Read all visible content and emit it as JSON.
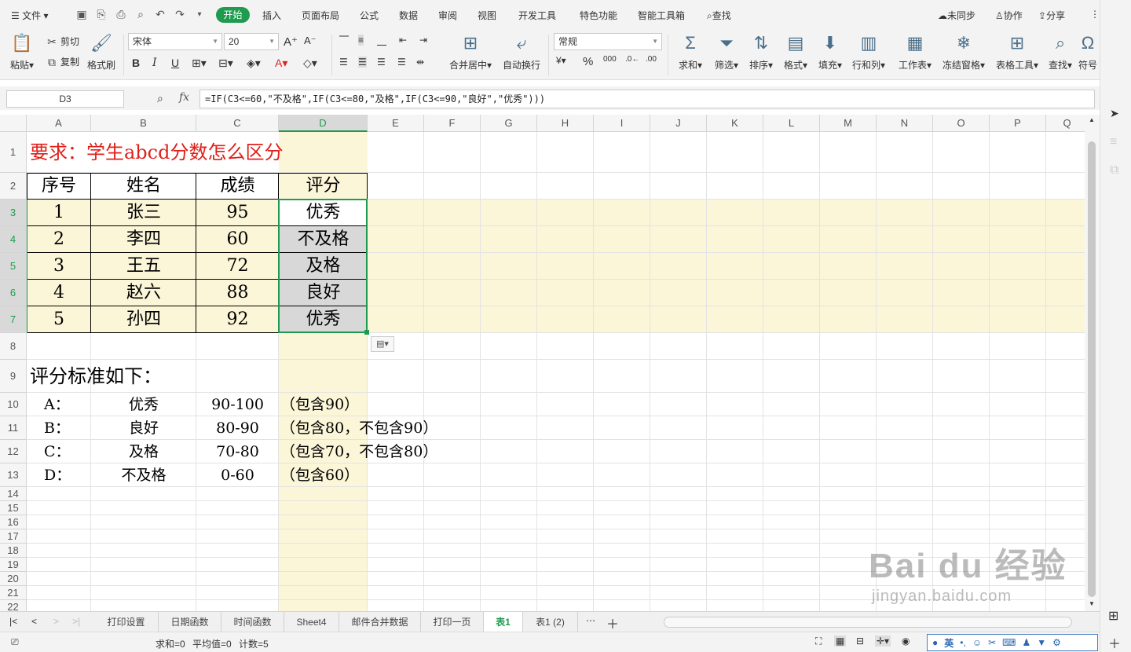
{
  "menubar": {
    "file": "文件",
    "tabs": [
      "开始",
      "插入",
      "页面布局",
      "公式",
      "数据",
      "审阅",
      "视图",
      "开发工具",
      "特色功能",
      "智能工具箱"
    ],
    "active_tab": "开始",
    "search": "查找",
    "sync": "未同步",
    "collab": "协作",
    "share": "分享"
  },
  "ribbon": {
    "paste": "粘贴",
    "cut": "剪切",
    "copy": "复制",
    "format_painter": "格式刷",
    "font_name": "宋体",
    "font_size": "20",
    "merge_center": "合并居中",
    "wrap_text": "自动换行",
    "number_format": "常规",
    "sum": "求和",
    "filter": "筛选",
    "sort": "排序",
    "format": "格式",
    "fill": "填充",
    "row_col": "行和列",
    "worksheet": "工作表",
    "freeze": "冻结窗格",
    "table_tools": "表格工具",
    "find": "查找",
    "symbol": "符号"
  },
  "formula_bar": {
    "name_box": "D3",
    "fx": "fx",
    "formula": "=IF(C3<=60,\"不及格\",IF(C3<=80,\"及格\",IF(C3<=90,\"良好\",\"优秀\")))"
  },
  "columns": [
    "A",
    "B",
    "C",
    "D",
    "E",
    "F",
    "G",
    "H",
    "I",
    "J",
    "K",
    "L",
    "M",
    "N",
    "O",
    "P",
    "Q"
  ],
  "rows": [
    "1",
    "2",
    "3",
    "4",
    "5",
    "6",
    "7",
    "8",
    "9",
    "10",
    "11",
    "12",
    "13",
    "14",
    "15",
    "16",
    "17",
    "18",
    "19",
    "20",
    "21",
    "22"
  ],
  "sheet": {
    "title": "要求：学生abcd分数怎么区分",
    "headers": [
      "序号",
      "姓名",
      "成绩",
      "评分"
    ],
    "data": [
      [
        "1",
        "张三",
        "95",
        "优秀"
      ],
      [
        "2",
        "李四",
        "60",
        "不及格"
      ],
      [
        "3",
        "王五",
        "72",
        "及格"
      ],
      [
        "4",
        "赵六",
        "88",
        "良好"
      ],
      [
        "5",
        "孙四",
        "92",
        "优秀"
      ]
    ],
    "criteria_title": "评分标准如下：",
    "criteria": [
      [
        "A：",
        "优秀",
        "90-100",
        "（包含90）"
      ],
      [
        "B：",
        "良好",
        "80-90",
        "（包含80，不包含90）"
      ],
      [
        "C：",
        "及格",
        "70-80",
        "（包含70，不包含80）"
      ],
      [
        "D：",
        "不及格",
        "0-60",
        "（包含60）"
      ]
    ]
  },
  "sheet_tabs": [
    "打印设置",
    "日期函数",
    "时间函数",
    "Sheet4",
    "邮件合并数据",
    "打印一页",
    "表1",
    "表1 (2)"
  ],
  "active_sheet": "表1",
  "status": {
    "sum": "求和=0",
    "avg": "平均值=0",
    "count": "计数=5",
    "ime": "英"
  },
  "watermark": {
    "brand": "Bai du 经验",
    "url": "jingyan.baidu.com"
  },
  "colors": {
    "accent": "#1e9b4e",
    "highlight": "#fbf6d8",
    "title_red": "#e0201b",
    "selection": "#1e9b4e"
  }
}
